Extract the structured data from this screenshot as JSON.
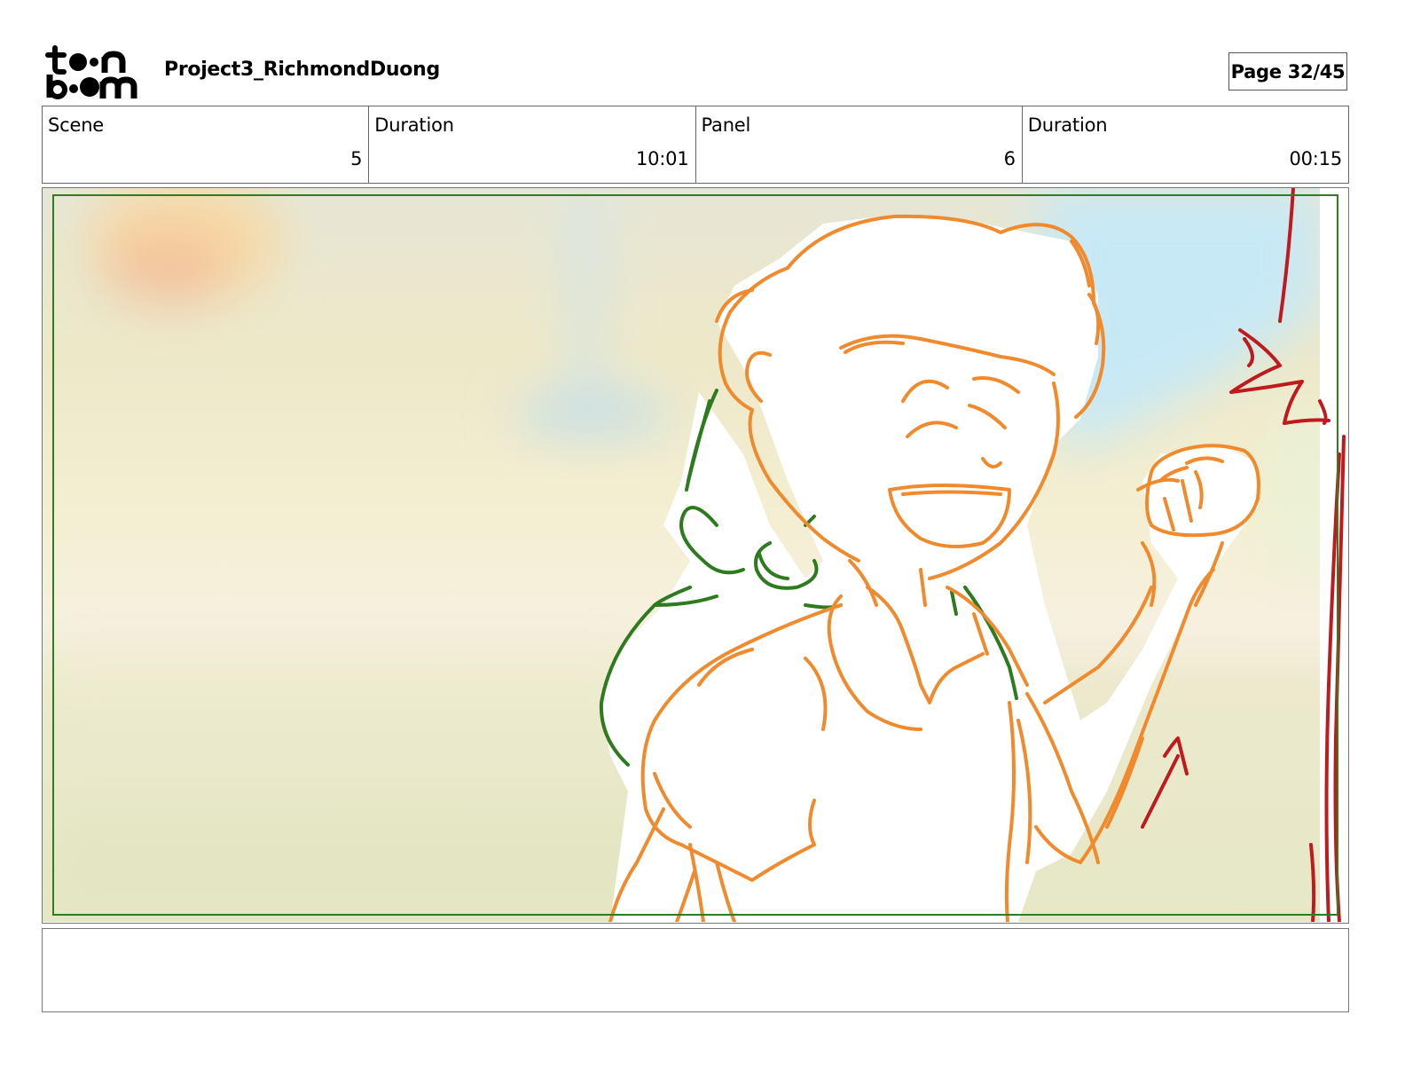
{
  "header": {
    "logo_top": "t  n",
    "logo_bottom": "b  m",
    "project_title": "Project3_RichmondDuong",
    "page_label": "Page 32/45"
  },
  "info": {
    "scene_label": "Scene",
    "scene_value": "5",
    "scene_duration_label": "Duration",
    "scene_duration_value": "10:01",
    "panel_label": "Panel",
    "panel_value": "6",
    "panel_duration_label": "Duration",
    "panel_duration_value": "00:15"
  },
  "panel": {
    "safe_frame_color": "#2e7d1e",
    "character_main_color": "#f08a2c",
    "character_back_color": "#2d7a1f",
    "motion_marks_color": "#c0191e"
  },
  "notes": {
    "text": ""
  }
}
